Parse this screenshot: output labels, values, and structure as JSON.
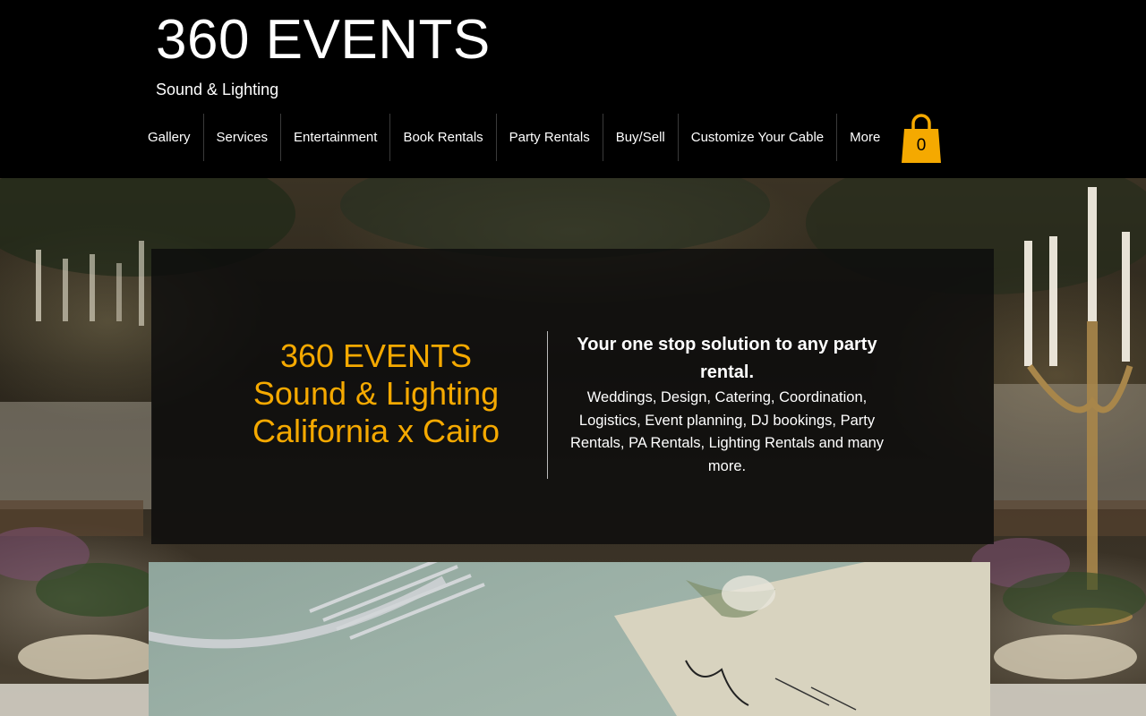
{
  "header": {
    "title": "360 EVENTS",
    "subtitle": "Sound & Lighting"
  },
  "nav": {
    "items": [
      {
        "label": "Gallery"
      },
      {
        "label": "Services"
      },
      {
        "label": "Entertainment"
      },
      {
        "label": "Book Rentals"
      },
      {
        "label": "Party Rentals"
      },
      {
        "label": "Buy/Sell"
      },
      {
        "label": "Customize Your Cable"
      },
      {
        "label": "More"
      }
    ]
  },
  "cart": {
    "count": "0",
    "icon": "shopping-bag-icon",
    "color": "#f5a900"
  },
  "hero": {
    "left_lines": [
      "360 EVENTS",
      "Sound & Lighting",
      "California x Cairo"
    ],
    "right_heading": "Your one stop solution to any party rental.",
    "right_body": "Weddings, Design, Catering, Coordination, Logistics, Event planning, DJ bookings, Party Rentals, PA Rentals, Lighting Rentals and many more.",
    "accent_color": "#f5a900"
  }
}
